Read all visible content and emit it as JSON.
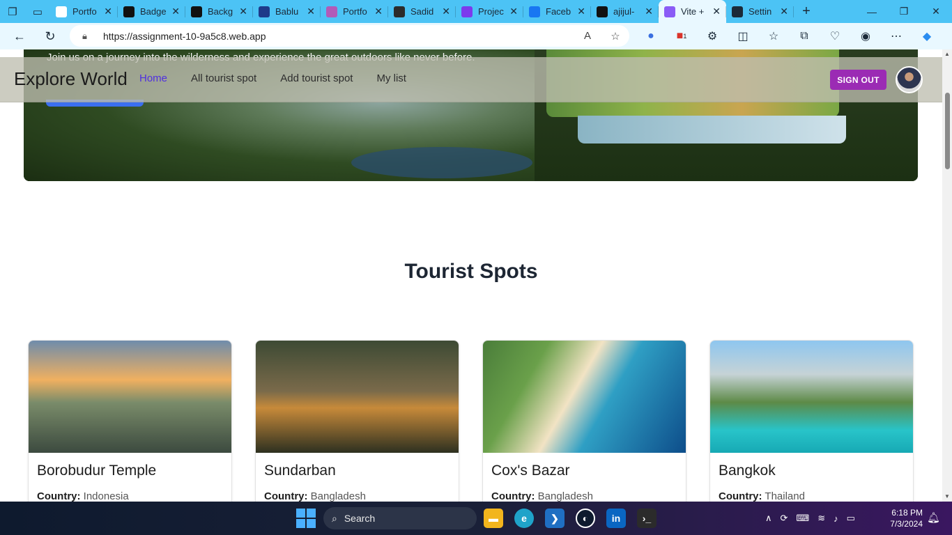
{
  "browser": {
    "tabs": [
      {
        "title": "Portfo",
        "fav": "doc-icon",
        "color": "#ffffff"
      },
      {
        "title": "Badge",
        "fav": "badge-icon",
        "color": "#111111"
      },
      {
        "title": "Backg",
        "fav": "play-icon",
        "color": "#111111"
      },
      {
        "title": "Bablu",
        "fav": "b-icon",
        "color": "#1e3a8a"
      },
      {
        "title": "Portfo",
        "fav": "portfolio-icon",
        "color": "#b15bb8"
      },
      {
        "title": "Sadid",
        "fav": "sadid-icon",
        "color": "#2b2b2b"
      },
      {
        "title": "Projec",
        "fav": "t-icon",
        "color": "#7c3aed"
      },
      {
        "title": "Faceb",
        "fav": "facebook-icon",
        "color": "#1877f2"
      },
      {
        "title": "ajijul-",
        "fav": "github-icon",
        "color": "#111111"
      },
      {
        "title": "Vite +",
        "fav": "vite-icon",
        "color": "#8a5cf6",
        "active": true
      },
      {
        "title": "Settin",
        "fav": "gear-icon",
        "color": "#1b2a38"
      }
    ],
    "url": "https://assignment-10-9a5c8.web.app",
    "extension_badge": "1"
  },
  "hero": {
    "tagline": "Join us on a journey into the wilderness and experience the great outdoors like never before."
  },
  "navbar": {
    "brand": "Explore World",
    "links": [
      "Home",
      "All tourist spot",
      "Add tourist spot",
      "My list"
    ],
    "active_link": "Home",
    "signout_label": "SIGN OUT"
  },
  "section": {
    "title": "Tourist Spots"
  },
  "cards": [
    {
      "name": "Borobudur Temple",
      "country_label": "Country:",
      "country": "Indonesia"
    },
    {
      "name": "Sundarban",
      "country_label": "Country:",
      "country": "Bangladesh"
    },
    {
      "name": "Cox's Bazar",
      "country_label": "Country:",
      "country": "Bangladesh"
    },
    {
      "name": "Bangkok",
      "country_label": "Country:",
      "country": "Thailand"
    }
  ],
  "taskbar": {
    "search_label": "Search",
    "time": "6:18 PM",
    "date": "7/3/2024"
  }
}
